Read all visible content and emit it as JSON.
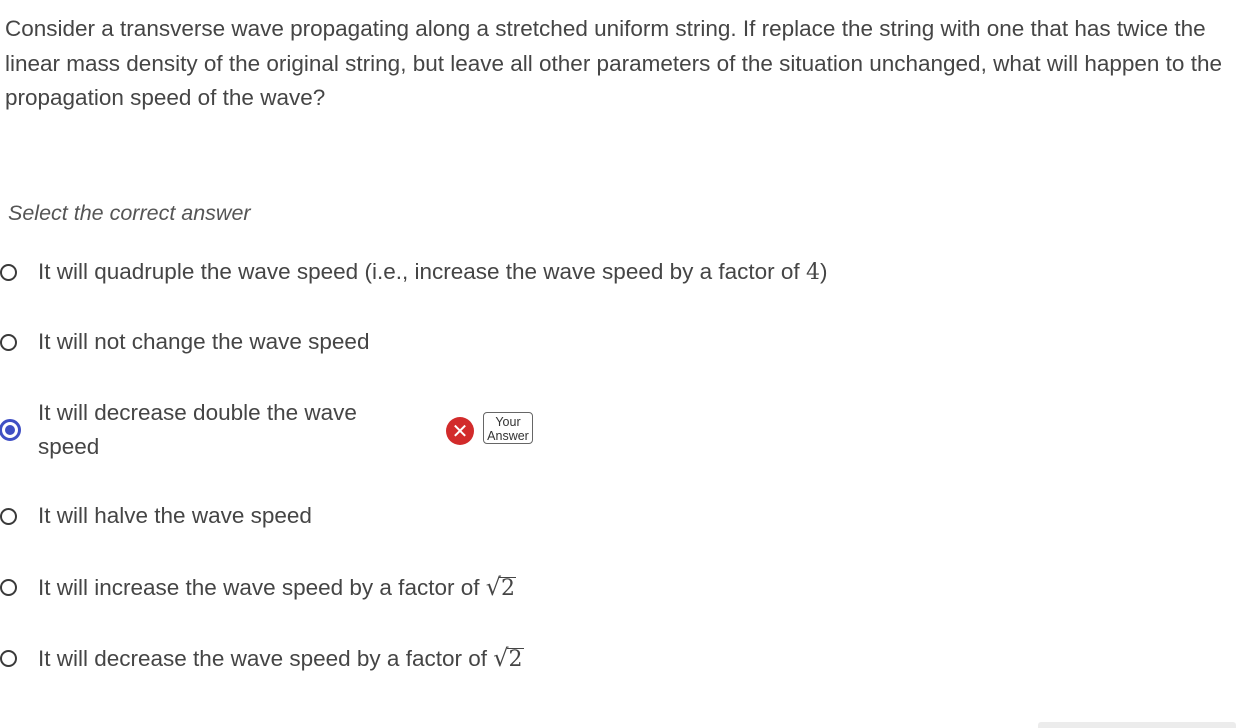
{
  "question": {
    "text": "Consider a transverse wave propagating along a stretched uniform string.  If replace the string with one that has twice the linear mass density of the original string, but leave all other parameters of the situation unchanged, what will happen to the propagation speed of the wave?"
  },
  "prompt": "Select the correct answer",
  "options": [
    {
      "text": "It will quadruple the wave speed (i.e., increase the wave speed by a factor of ",
      "math": "4",
      "suffix": ")",
      "selected": false
    },
    {
      "text": "It will not change the wave speed",
      "selected": false
    },
    {
      "text": "It will decrease double the wave speed",
      "selected": true
    },
    {
      "text": "It will halve the wave speed",
      "selected": false
    },
    {
      "text": "It will increase the wave speed by a factor of ",
      "sqrt": "2",
      "selected": false
    },
    {
      "text": "It will decrease the wave speed by a factor of ",
      "sqrt": "2",
      "selected": false
    }
  ],
  "feedback": {
    "icon": "wrong-x-icon",
    "icon_glyph": "✕",
    "status_color": "#d22b2b",
    "badge_line1": "Your",
    "badge_line2": "Answer"
  },
  "colors": {
    "selected_radio": "#3f4fc4",
    "text": "#454545"
  }
}
